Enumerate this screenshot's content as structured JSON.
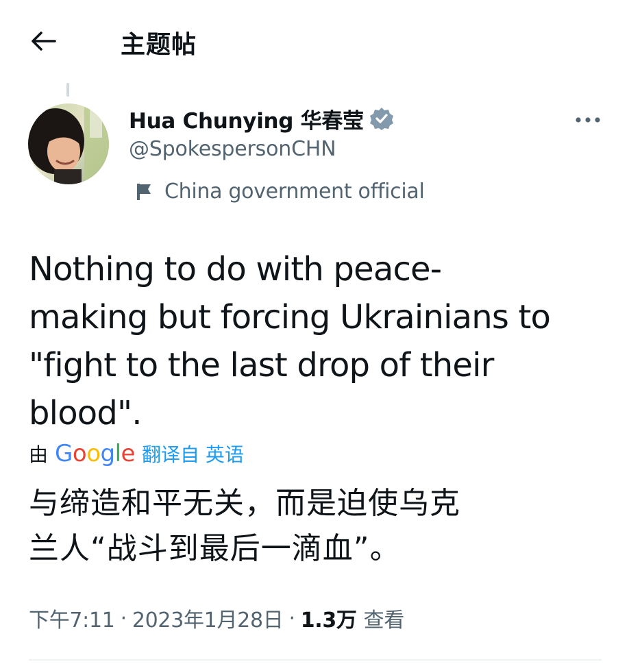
{
  "header": {
    "title": "主题帖",
    "back_icon": "arrow-left-icon"
  },
  "author": {
    "display_name": "Hua Chunying 华春莹",
    "handle": "@SpokespersonCHN",
    "verified_icon": "verified-badge-icon",
    "label_icon": "flag-icon",
    "label": "China government official"
  },
  "more_icon": "more-dots-icon",
  "tweet": {
    "text": "Nothing to do with peace-\nmaking but forcing Ukrainians to\n\"fight to the last drop of their\nblood\".",
    "translate_prefix": "由",
    "translate_provider": "Google",
    "translate_link": "翻译自 英语",
    "translated_text": "与缔造和平无关，而是迫使乌克\n兰人“战斗到最后一滴血”。"
  },
  "meta": {
    "time": "下午7:11",
    "separator": "·",
    "date": "2023年1月28日",
    "views_count": "1.3万",
    "views_label": "查看"
  },
  "colors": {
    "text_primary": "#0f1419",
    "text_secondary": "#536471",
    "link_blue": "#1d9bf0",
    "verified_gray": "#829aab",
    "google_blue": "#4285F4",
    "google_red": "#EA4335",
    "google_yellow": "#FBBC05",
    "google_green": "#34A853"
  }
}
